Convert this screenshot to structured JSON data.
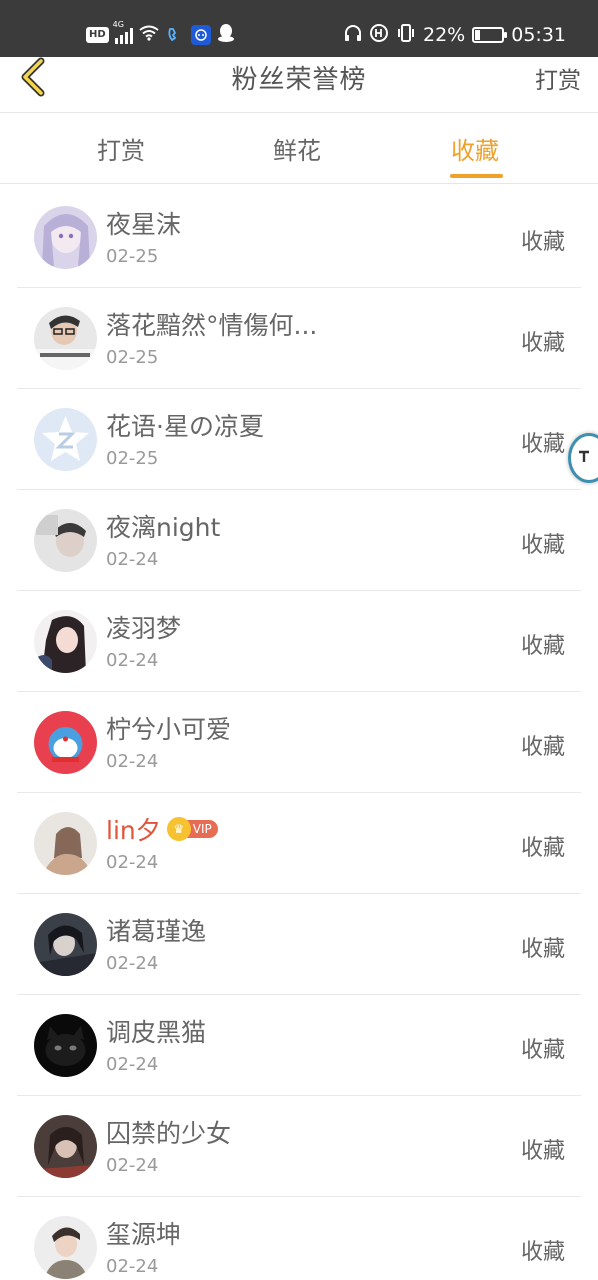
{
  "status_bar": {
    "hd": "HD",
    "network": "4G",
    "battery_percent_text": "22%",
    "battery_level": 0.22,
    "time": "05:31"
  },
  "header": {
    "title": "粉丝荣誉榜",
    "action_label": "打赏"
  },
  "tabs": [
    {
      "label": "打赏",
      "active": false
    },
    {
      "label": "鲜花",
      "active": false
    },
    {
      "label": "收藏",
      "active": true
    }
  ],
  "accent_color": "#f0a12a",
  "list": [
    {
      "name": "夜星沫",
      "date": "02-25",
      "action": "收藏",
      "vip": false
    },
    {
      "name": "落花黯然°情傷何...",
      "date": "02-25",
      "action": "收藏",
      "vip": false
    },
    {
      "name": "花语·星の凉夏",
      "date": "02-25",
      "action": "收藏",
      "vip": false
    },
    {
      "name": "夜漓night",
      "date": "02-24",
      "action": "收藏",
      "vip": false
    },
    {
      "name": "凌羽梦",
      "date": "02-24",
      "action": "收藏",
      "vip": false
    },
    {
      "name": "柠兮小可爱",
      "date": "02-24",
      "action": "收藏",
      "vip": false
    },
    {
      "name": "lin夕",
      "date": "02-24",
      "action": "收藏",
      "vip": true,
      "vip_label": "VIP"
    },
    {
      "name": "诸葛瑾逸",
      "date": "02-24",
      "action": "收藏",
      "vip": false
    },
    {
      "name": "调皮黑猫",
      "date": "02-24",
      "action": "收藏",
      "vip": false
    },
    {
      "name": "囚禁的少女",
      "date": "02-24",
      "action": "收藏",
      "vip": false
    },
    {
      "name": "玺源坤",
      "date": "02-24",
      "action": "收藏",
      "vip": false
    }
  ]
}
